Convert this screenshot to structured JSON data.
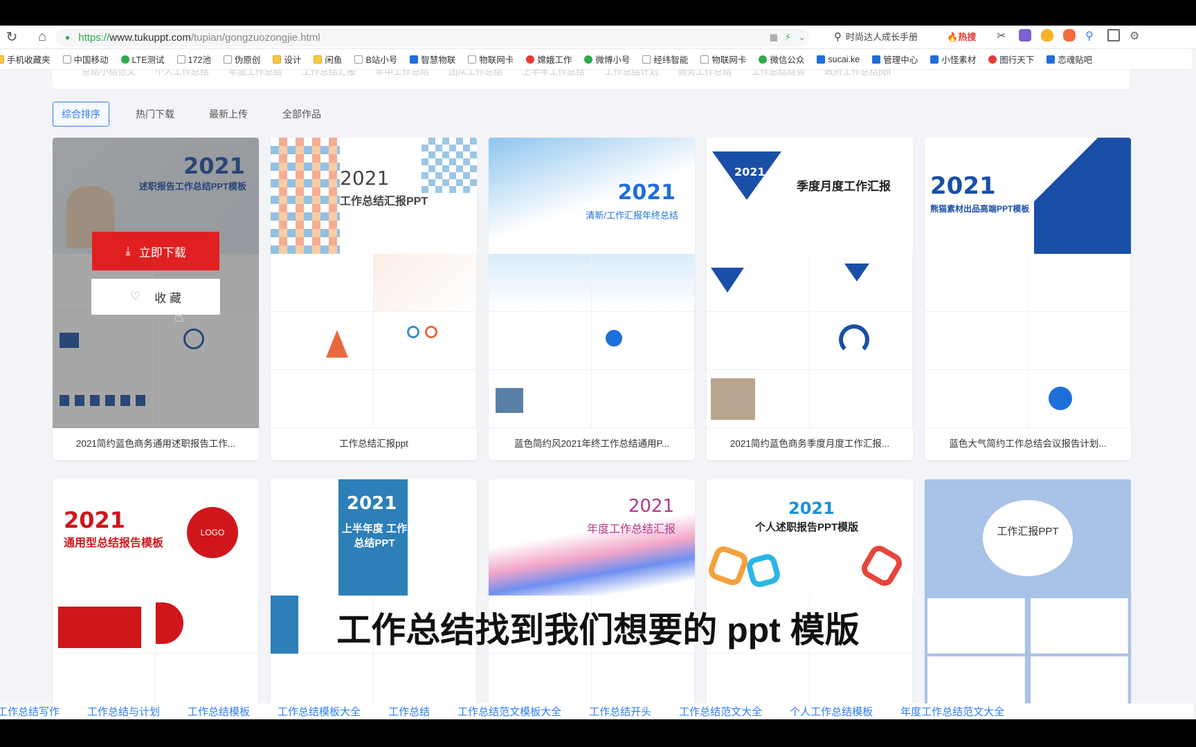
{
  "browser": {
    "url_scheme": "https://",
    "url_host": "www.tukuppt.com",
    "url_path": "/tupian/gongzuozongjie.html",
    "search_text": "时尚达人成长手册",
    "hot_label": "热搜"
  },
  "bookmarks": [
    {
      "label": "手机收藏夹",
      "icon": "folder-icon"
    },
    {
      "label": "中国移动",
      "icon": "page-icon"
    },
    {
      "label": "LTE测试",
      "icon": "green-icon"
    },
    {
      "label": "172池",
      "icon": "page-icon"
    },
    {
      "label": "伪原创",
      "icon": "page-icon"
    },
    {
      "label": "设计",
      "icon": "folder-icon"
    },
    {
      "label": "闲鱼",
      "icon": "folder-icon"
    },
    {
      "label": "B站小号",
      "icon": "page-icon"
    },
    {
      "label": "智慧物联",
      "icon": "blue-icon"
    },
    {
      "label": "物联网卡",
      "icon": "page-icon"
    },
    {
      "label": "嫦娥工作",
      "icon": "red-icon"
    },
    {
      "label": "微博小号",
      "icon": "green-icon"
    },
    {
      "label": "经纬智能",
      "icon": "page-icon"
    },
    {
      "label": "物联网卡",
      "icon": "page-icon"
    },
    {
      "label": "微信公众",
      "icon": "green-icon"
    },
    {
      "label": "sucai.ke",
      "icon": "blue-icon"
    },
    {
      "label": "管理中心",
      "icon": "blue-icon"
    },
    {
      "label": "小怪素材",
      "icon": "blue-icon"
    },
    {
      "label": "图行天下",
      "icon": "red-icon"
    },
    {
      "label": "恋魂贴吧",
      "icon": "blue-icon"
    }
  ],
  "tag_strip": [
    "总结小结范文",
    "个人工作总结",
    "年度工作总结",
    "工作总结汇报",
    "年中工作总结",
    "团队工作总结",
    "上半年工作总结",
    "工作总结计划",
    "商务工作总结",
    "工作总结财务",
    "政府工作总结ppt"
  ],
  "sort_tabs": [
    "综合排序",
    "热门下载",
    "最新上传",
    "全部作品"
  ],
  "cards": [
    {
      "title": "2021简约蓝色商务通用述职报告工作...",
      "year": "2021",
      "heading": "述职报告工作总结PPT模板"
    },
    {
      "title": "工作总结汇报ppt",
      "year": "2021",
      "heading": "工作总结汇报PPT"
    },
    {
      "title": "蓝色简约风2021年终工作总结通用P...",
      "year": "2021",
      "heading": "清新/工作汇报年终总结"
    },
    {
      "title": "2021简约蓝色商务季度月度工作汇报...",
      "year": "2021",
      "heading": "季度月度工作汇报"
    },
    {
      "title": "蓝色大气简约工作总结会议报告计划...",
      "year": "2021",
      "heading": "熊猫素材出品高端PPT模板"
    },
    {
      "title": "",
      "year": "2021",
      "heading": "通用型总结报告模板"
    },
    {
      "title": "",
      "year": "2021",
      "heading": "上半年度 工作总结PPT"
    },
    {
      "title": "",
      "year": "2021",
      "heading": "年度工作总结汇报"
    },
    {
      "title": "",
      "year": "2021",
      "heading": "个人述职报告PPT模版"
    },
    {
      "title": "",
      "year": "",
      "heading": "工作汇报PPT"
    }
  ],
  "hover": {
    "download_label": "立即下载",
    "favorite_label": "收 藏"
  },
  "subtitle": "工作总结找到我们想要的 ppt 模版",
  "footer_links": [
    "工作总结写作",
    "工作总结与计划",
    "工作总结模板",
    "工作总结模板大全",
    "工作总结",
    "工作总结范文模板大全",
    "工作总结开头",
    "工作总结范文大全",
    "个人工作总结模板",
    "年度工作总结范文大全"
  ],
  "colors": {
    "accent": "#2f7df6",
    "download": "#e02020",
    "brand_blue": "#1a4fa8"
  }
}
